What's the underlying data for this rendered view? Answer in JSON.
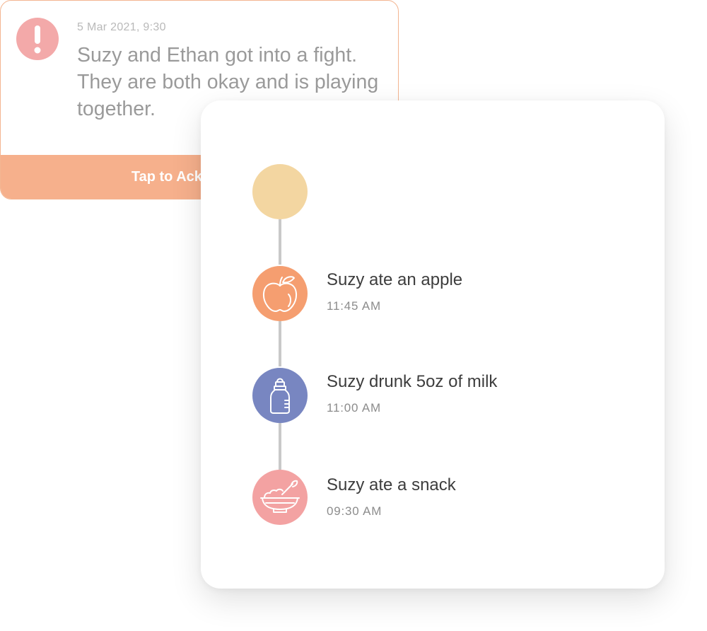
{
  "alert": {
    "date": "5 Mar 2021, 9:30",
    "message": "Suzy and Ethan got into a fight. They are both okay and is playing together.",
    "action_label": "Tap to Acknowledge",
    "icon": "exclamation-icon",
    "accent_color": "#F6B08C",
    "icon_color": "#F3A9A9"
  },
  "timeline": {
    "items": [
      {
        "icon": "empty-circle",
        "color": "#F3D6A1",
        "title": "",
        "time": ""
      },
      {
        "icon": "apple-icon",
        "color": "#F59E70",
        "title": "Suzy ate an apple",
        "time": "11:45 AM"
      },
      {
        "icon": "baby-bottle-icon",
        "color": "#7886C1",
        "title": "Suzy drunk 5oz of milk",
        "time": "11:00 AM"
      },
      {
        "icon": "bowl-icon",
        "color": "#F3A2A2",
        "title": "Suzy ate a snack",
        "time": "09:30 AM"
      }
    ]
  }
}
